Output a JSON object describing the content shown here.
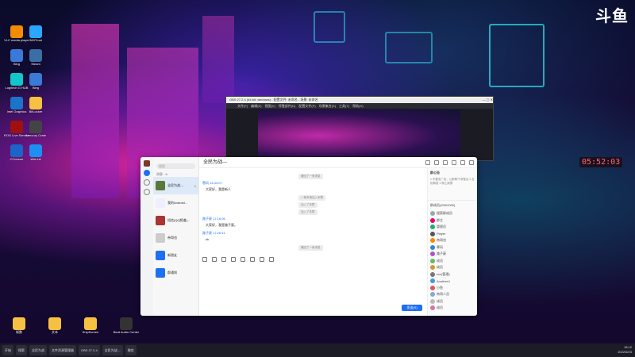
{
  "watermark": "斗鱼",
  "desktop_clock": "05:52:03",
  "desktop_icons": [
    {
      "label": "VLC media player",
      "color": "#f28c00"
    },
    {
      "label": "360Trust",
      "color": "#2aa7ff"
    },
    {
      "label": "Bing",
      "color": "#3a79d6"
    },
    {
      "label": "Steam",
      "color": "#3a6ea5"
    },
    {
      "label": "Logitech G HUB",
      "color": "#13c6c9"
    },
    {
      "label": "Bing",
      "color": "#3a79d6"
    },
    {
      "label": "Intel Graphics",
      "color": "#1a74c9"
    },
    {
      "label": "BitLocker",
      "color": "#f6c142"
    },
    {
      "label": "ROG Live Service",
      "color": "#a01010"
    },
    {
      "label": "Armoury Crate",
      "color": "#444"
    },
    {
      "label": "CCleaner",
      "color": "#1c64c8"
    },
    {
      "label": "WeLink",
      "color": "#1b8ff2"
    },
    {
      "label": "帧数",
      "color": "#f6c142"
    },
    {
      "label": "文本",
      "color": "#f6c142"
    },
    {
      "label": "SnipScreen",
      "color": "#f6c142"
    },
    {
      "label": "Beat Audio Center",
      "color": "#333"
    }
  ],
  "obs": {
    "title": "OBS 27.2.4 (64-bit, windows) - 配置文件: 未命名 - 场景: 未命名",
    "menus": [
      "文件(F)",
      "编辑(E)",
      "视图(V)",
      "停靠部件(D)",
      "配置文件(P)",
      "场景集合(S)",
      "工具(T)",
      "帮助(H)"
    ]
  },
  "chat": {
    "search_placeholder": "搜索",
    "group_header": "消息 · 6",
    "conversations": [
      {
        "name": "全民为战---",
        "badge": "6",
        "selected": true,
        "color": "#5a7a3a"
      },
      {
        "name": "我的Android...",
        "badge": "",
        "selected": false,
        "color": "#eef"
      },
      {
        "name": "短信(QQ频道)...",
        "badge": "",
        "selected": false,
        "color": "#a33"
      },
      {
        "name": "帝哥也",
        "badge": "",
        "selected": false,
        "color": "#ccc"
      },
      {
        "name": "新朋友",
        "badge": "",
        "selected": false,
        "color": "#1e6ff2"
      },
      {
        "name": "群通知",
        "badge": "",
        "selected": false,
        "color": "#1e6ff2"
      }
    ],
    "title": "全民为战---",
    "messages": [
      {
        "kind": "sys",
        "text": "撤回了一条消息"
      },
      {
        "kind": "name",
        "text": "寒风 14:44:07"
      },
      {
        "kind": "line",
        "text": "大家好，我是新人"
      },
      {
        "kind": "sys",
        "text": "一条申请加入本群"
      },
      {
        "kind": "sys",
        "text": "加入了本群"
      },
      {
        "kind": "sys",
        "text": "加入了本群"
      },
      {
        "kind": "name",
        "text": "路子豪 17:16:06"
      },
      {
        "kind": "line",
        "text": "大家好，我是路子豪。"
      },
      {
        "kind": "name",
        "text": "路子豪 17:26:41"
      },
      {
        "kind": "line",
        "text": "ok"
      },
      {
        "kind": "sys",
        "text": "撤回了一条消息"
      }
    ],
    "send_label": "发送(S)",
    "notice_title": "群公告",
    "notice_text": "1.不要发广告，让群聊干净整洁 2.互相尊重 3.禁止刷屏",
    "members_header": "群成员(205/2000)",
    "members": [
      "搜索群成员",
      "群主",
      "管理员",
      "Player",
      "帝哥也",
      "寒风",
      "路子豪",
      "成员",
      "成员",
      "ccc(管理)",
      "AnotherU",
      "小鱼",
      "帝哥人员",
      "成员",
      "成员"
    ]
  },
  "taskbar": {
    "items": [
      "开始",
      "搜索",
      "全民为战",
      "文件资源管理器",
      "OBS 27.2.4",
      "全民为战---",
      "微信"
    ],
    "time": "18:12",
    "date": "2022/6/23"
  }
}
